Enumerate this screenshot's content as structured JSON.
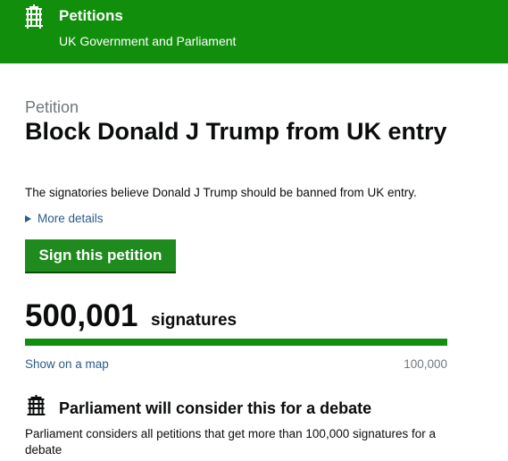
{
  "header": {
    "title": "Petitions",
    "subtitle": "UK Government and Parliament",
    "logo_icon": "portcullis-icon"
  },
  "petition": {
    "label": "Petition",
    "title": "Block Donald J Trump from UK entry",
    "summary": "The signatories believe Donald J Trump should be banned from UK entry.",
    "more_details": "More details",
    "sign_button": "Sign this petition"
  },
  "signatures": {
    "count": "500,001",
    "label": "signatures",
    "progress_fraction": 1.0,
    "map_link": "Show on a map",
    "threshold": "100,000"
  },
  "debate": {
    "icon": "portcullis-icon",
    "title": "Parliament will consider this for a debate",
    "text": "Parliament considers all petitions that get more than 100,000 signatures for a debate"
  },
  "colors": {
    "brand_green": "#118f0c",
    "button_green": "#1f8a1d",
    "link_blue": "#2b5a8c"
  }
}
